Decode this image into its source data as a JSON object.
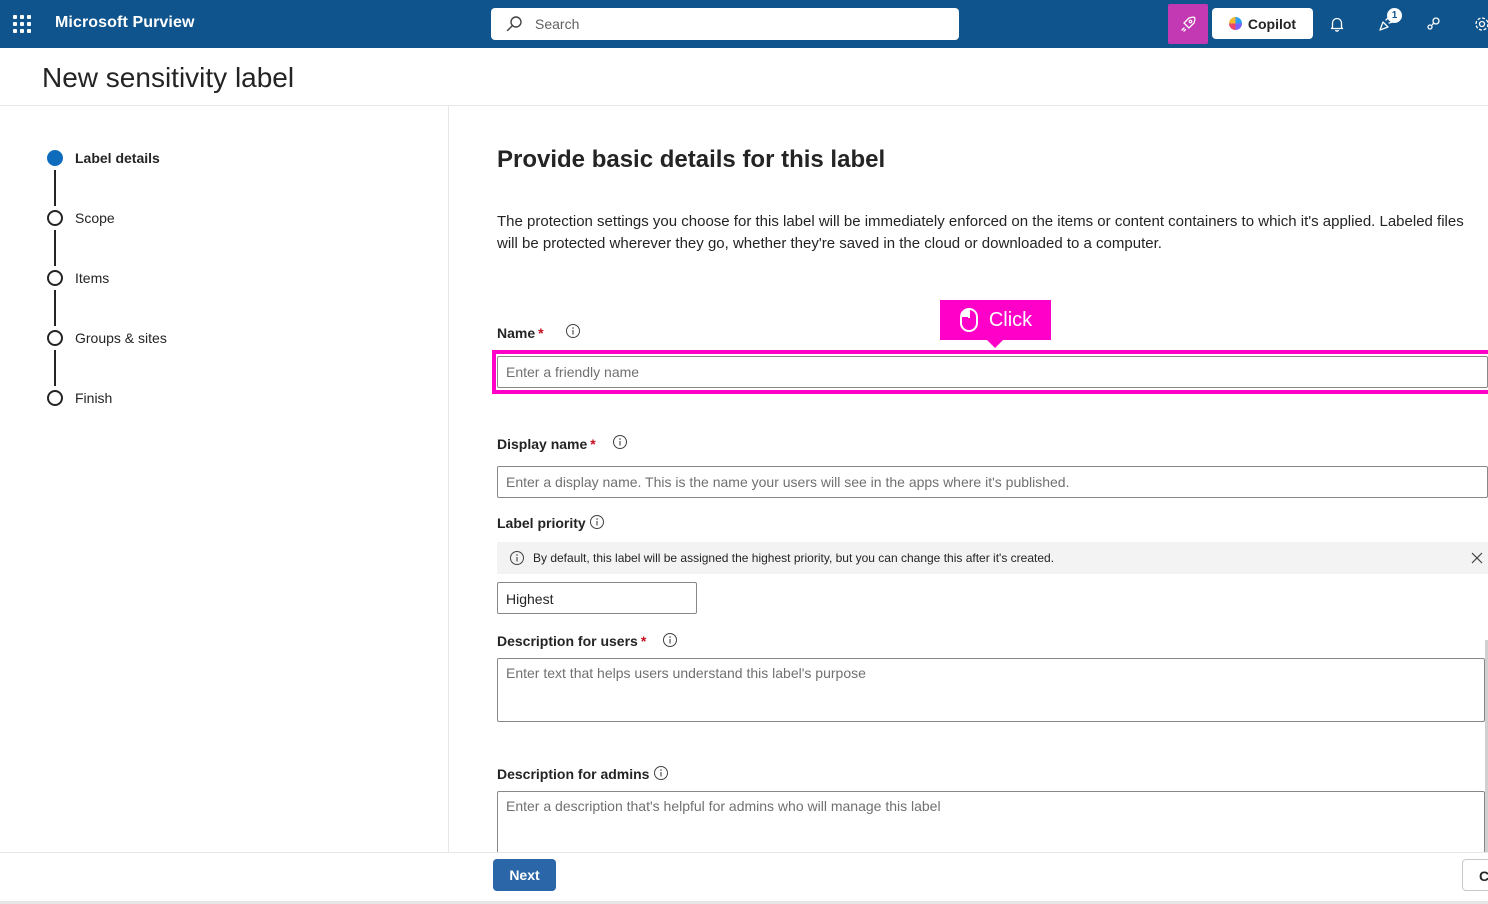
{
  "topbar": {
    "app_title": "Microsoft Purview",
    "search_placeholder": "Search",
    "copilot_label": "Copilot",
    "notification_badge": "1"
  },
  "page": {
    "title": "New sensitivity label"
  },
  "steps": [
    {
      "label": "Label details",
      "state": "current"
    },
    {
      "label": "Scope",
      "state": "pending"
    },
    {
      "label": "Items",
      "state": "pending"
    },
    {
      "label": "Groups & sites",
      "state": "pending"
    },
    {
      "label": "Finish",
      "state": "pending"
    }
  ],
  "form": {
    "title": "Provide basic details for this label",
    "intro": "The protection settings you choose for this label will be immediately enforced on the items or content containers to which it's applied. Labeled files will be protected wherever they go, whether they're saved in the cloud or downloaded to a computer.",
    "name": {
      "label": "Name",
      "required_mark": "*",
      "placeholder": "Enter a friendly name",
      "value": ""
    },
    "display_name": {
      "label": "Display name",
      "required_mark": "*",
      "placeholder": "Enter a display name. This is the name your users will see in the apps where it's published.",
      "value": ""
    },
    "priority": {
      "label": "Label priority",
      "message": "By default, this label will be assigned the highest priority, but you can change this after it's created.",
      "value": "Highest"
    },
    "description_users": {
      "label": "Description for users",
      "required_mark": "*",
      "placeholder": "Enter text that helps users understand this label's purpose",
      "value": ""
    },
    "description_admins": {
      "label": "Description for admins",
      "placeholder": "Enter a description that's helpful for admins who will manage this label",
      "value": ""
    }
  },
  "annotation": {
    "click_label": "Click"
  },
  "footer": {
    "next_label": "Next",
    "cancel_label": "Cancel"
  },
  "colors": {
    "topbar": "#0f548c",
    "accent": "#0f6cbd",
    "primary_button": "#2b66a8",
    "highlight": "#ff00c8",
    "required": "#c50f1f"
  }
}
